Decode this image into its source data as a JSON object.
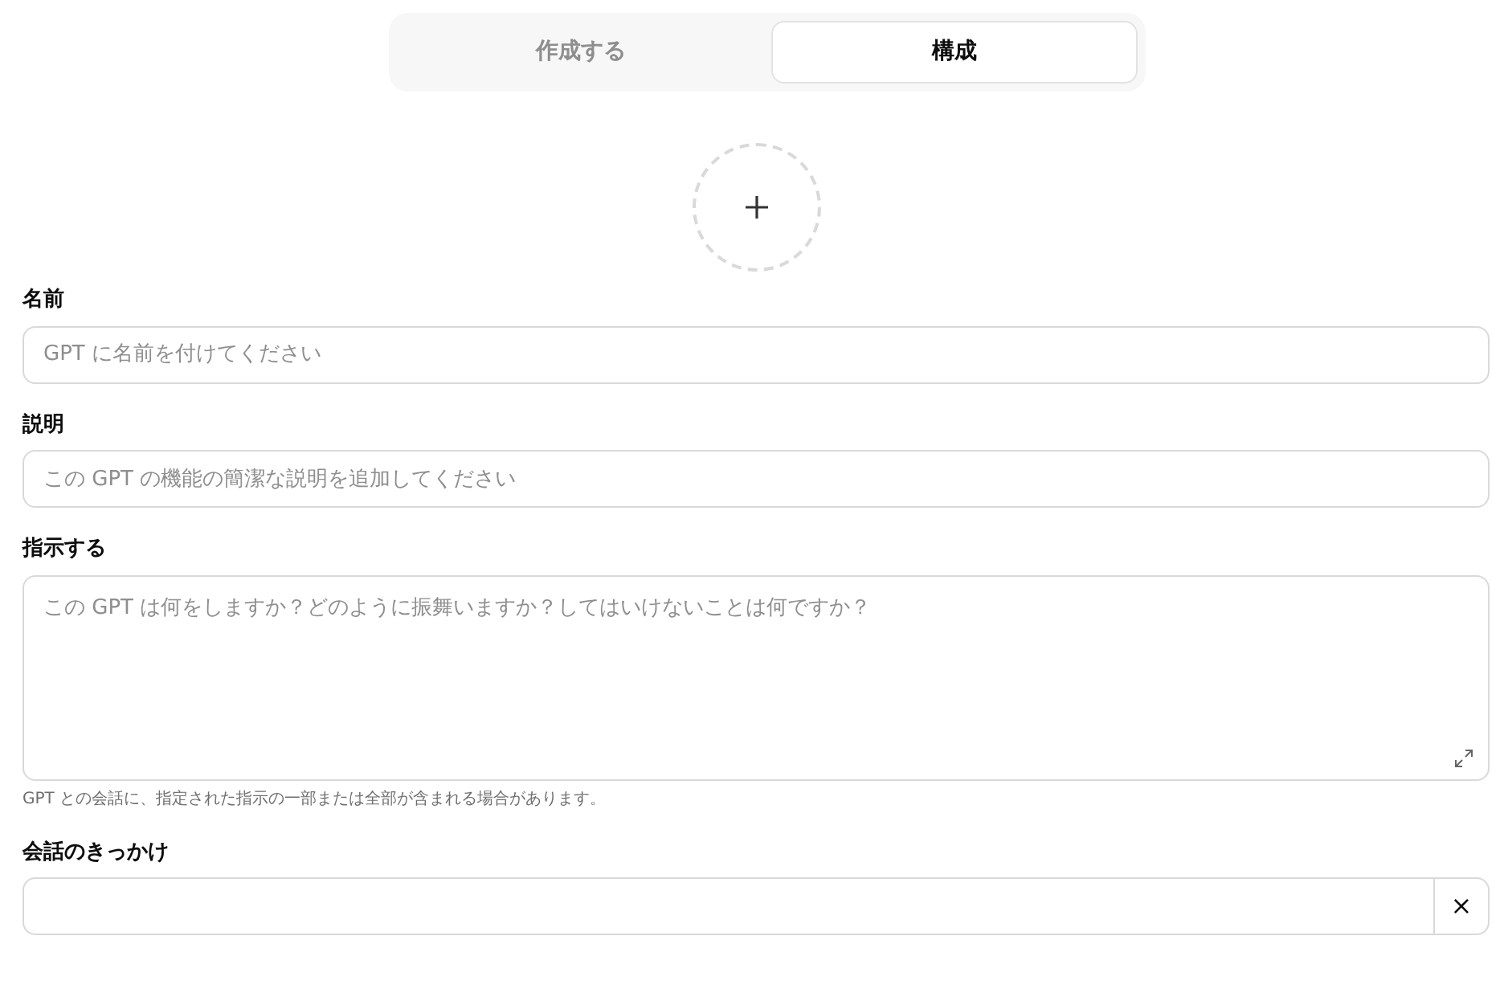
{
  "tabs": [
    {
      "label": "作成する",
      "selected": false
    },
    {
      "label": "構成",
      "selected": true
    }
  ],
  "fields": [
    {
      "kind": "input",
      "label": "名前",
      "placeholder": "GPT に名前を付けてください"
    },
    {
      "kind": "input",
      "label": "説明",
      "placeholder": "この GPT の機能の簡潔な説明を追加してください"
    },
    {
      "kind": "textarea",
      "label": "指示する",
      "placeholder": "この GPT は何をしますか？どのように振舞いますか？してはいけないことは何ですか？",
      "hint": "GPT との会話に、指定された指示の一部または全部が含まれる場合があります。"
    },
    {
      "kind": "removable",
      "label": "会話のきっかけ",
      "remove": "×"
    }
  ]
}
